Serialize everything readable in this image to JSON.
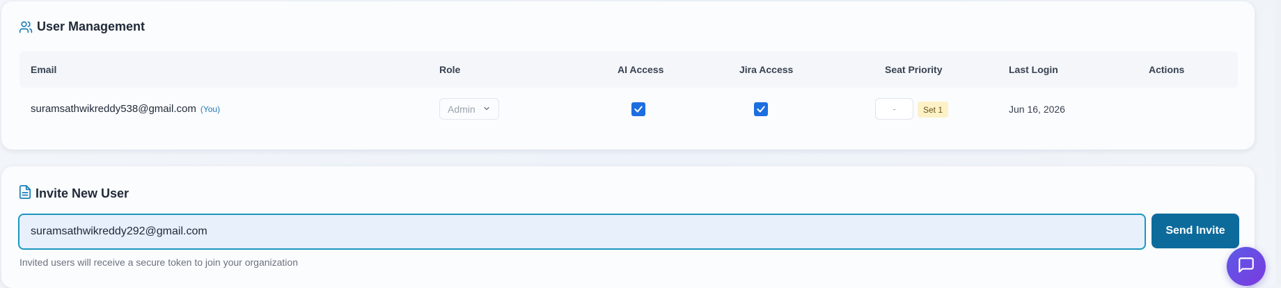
{
  "user_management": {
    "title": "User Management",
    "icon": "users-icon",
    "columns": {
      "email": "Email",
      "role": "Role",
      "ai_access": "AI Access",
      "jira_access": "Jira Access",
      "seat_priority": "Seat Priority",
      "last_login": "Last Login",
      "actions": "Actions"
    },
    "rows": [
      {
        "email": "suramsathwikreddy538@gmail.com",
        "you_tag": "(You)",
        "role": "Admin",
        "ai_access": true,
        "jira_access": true,
        "seat_priority": "-",
        "seat_badge": "Set 1",
        "last_login": "Jun 16, 2026"
      }
    ]
  },
  "invite": {
    "title": "Invite New User",
    "icon": "document-icon",
    "email_value": "suramsathwikreddy292@gmail.com",
    "send_label": "Send Invite",
    "hint": "Invited users will receive a secure token to join your organization"
  },
  "chat": {
    "icon": "chat-icon"
  },
  "colors": {
    "accent": "#0d6b9c",
    "checkbox": "#1d6fe0",
    "input_border": "#1b97bd",
    "badge_bg": "#fdf1c7",
    "fab_start": "#5b5be6",
    "fab_end": "#7c3ae0"
  }
}
